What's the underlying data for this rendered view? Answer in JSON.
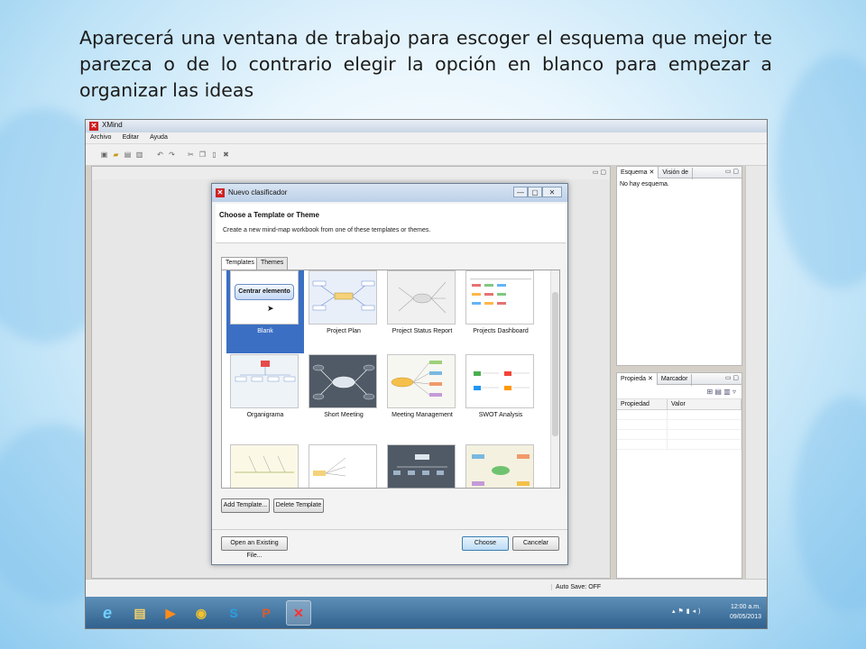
{
  "caption": "Aparecerá una ventana de trabajo para escoger el esquema que mejor te parezca o de lo contrario elegir la opción en blanco para empezar a organizar las ideas",
  "window": {
    "title": "XMind"
  },
  "menu": [
    "Archivo",
    "Editar",
    "Ayuda"
  ],
  "panes": {
    "outline_tab": "Esquema",
    "overview_tab": "Visión de",
    "outline_text": "No hay esquema.",
    "props_tab": "Propieda",
    "markers_tab": "Marcador",
    "props_col1": "Propiedad",
    "props_col2": "Valor"
  },
  "status": {
    "autosave": "Auto Save: OFF"
  },
  "dialog": {
    "title": "Nuevo clasificador",
    "heading": "Choose a Template or Theme",
    "description": "Create a new mind-map workbook from one of these templates or themes.",
    "tabs": [
      "Templates",
      "Themes"
    ],
    "blank_button": "Centrar elemento",
    "templates": [
      "Blank",
      "Project Plan",
      "Project Status Report",
      "Projects Dashboard",
      "Organigrama",
      "Short Meeting",
      "Meeting Management",
      "SWOT Analysis"
    ],
    "add_template": "Add Template...",
    "delete_template": "Delete Template",
    "open_existing": "Open an Existing File...",
    "choose": "Choose",
    "cancel": "Cancelar"
  },
  "taskbar": {
    "time": "12:00 a.m.",
    "date": "09/05/2013"
  },
  "colors": {
    "selection": "#3b6fc4",
    "taskbar": "#2e5f8c",
    "brand": "#d02020"
  }
}
